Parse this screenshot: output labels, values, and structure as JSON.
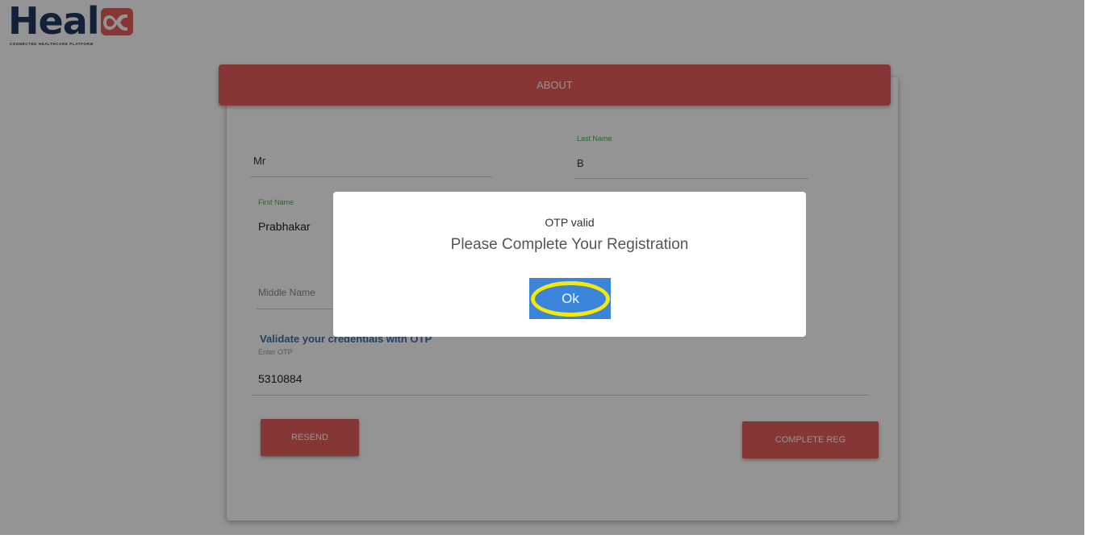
{
  "brand": {
    "logo_text": "Heal",
    "logo_tagline": "CONNECTED HEALTHCARE PLATFORM",
    "color_dark": "#1f3a5f",
    "color_accent": "#e85d5d"
  },
  "card": {
    "header_title": "ABOUT"
  },
  "form": {
    "title_value": "Mr",
    "last_name_label": "Last Name",
    "last_name_value": "B",
    "first_name_label": "First Name",
    "first_name_value": "Prabhakar",
    "middle_name_placeholder": "Middle Name",
    "otp_section_title": "Validate your credentials with OTP",
    "otp_label": "Enter OTP",
    "otp_value": "5310884"
  },
  "buttons": {
    "resend": "RESEND",
    "complete": "COMPLETE REG"
  },
  "modal": {
    "title": "OTP valid",
    "message": "Please Complete Your Registration",
    "ok_label": "Ok",
    "ok_color": "#3a84d9",
    "highlight_color": "#f5e90a"
  }
}
